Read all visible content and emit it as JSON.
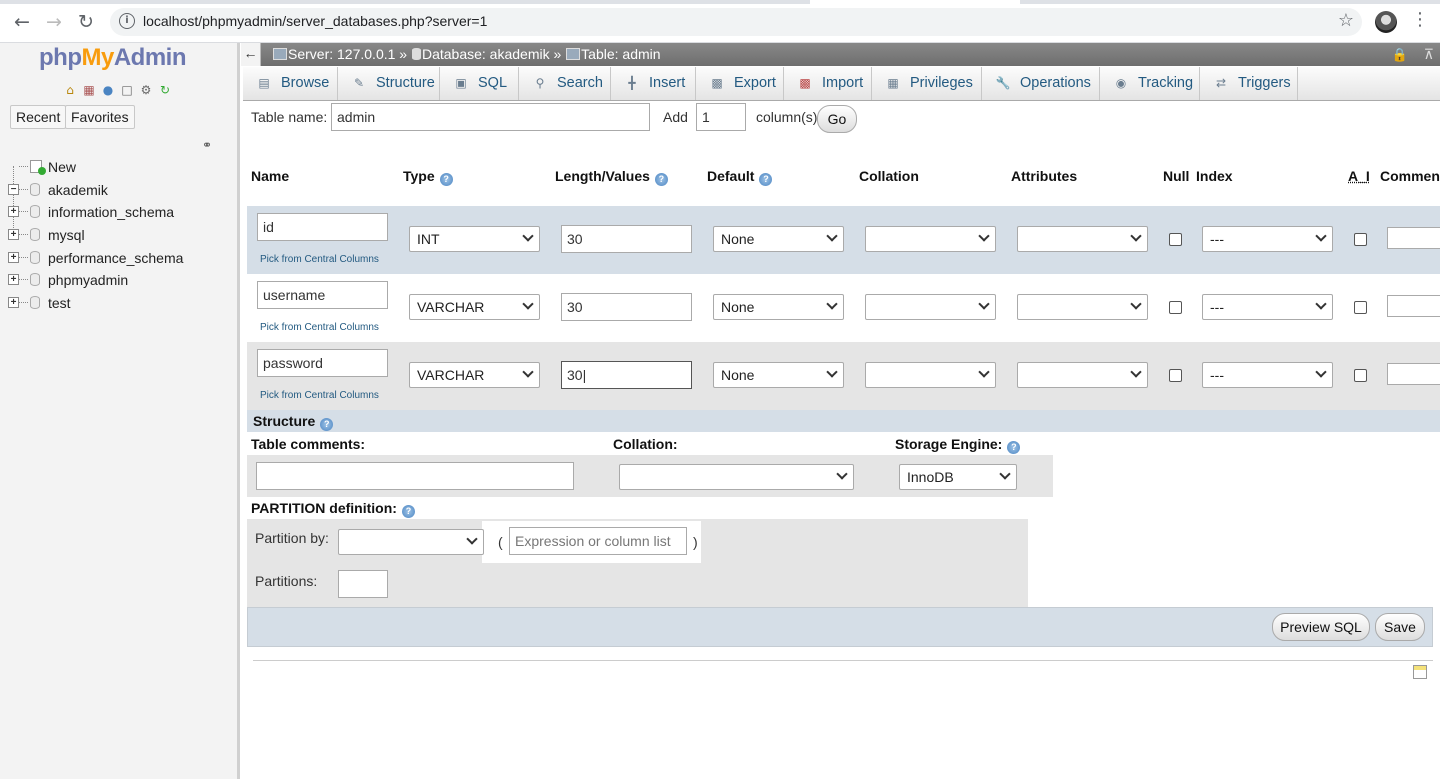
{
  "browser": {
    "url": "localhost/phpmyadmin/server_databases.php?server=1"
  },
  "nav": {
    "logo": {
      "php": "php",
      "my": "My",
      "admin": "Admin"
    },
    "recent_label": "Recent",
    "favorites_label": "Favorites",
    "tree": [
      {
        "label": "New",
        "expander": ""
      },
      {
        "label": "akademik",
        "expander": "−"
      },
      {
        "label": "information_schema",
        "expander": "+"
      },
      {
        "label": "mysql",
        "expander": "+"
      },
      {
        "label": "performance_schema",
        "expander": "+"
      },
      {
        "label": "phpmyadmin",
        "expander": "+"
      },
      {
        "label": "test",
        "expander": "+"
      }
    ]
  },
  "breadcrumb": {
    "server": "Server: 127.0.0.1 »",
    "database": "Database: akademik »",
    "table": "Table: admin"
  },
  "tabs": [
    {
      "label": "Browse",
      "icon": "browse-icon"
    },
    {
      "label": "Structure",
      "icon": "structure-icon"
    },
    {
      "label": "SQL",
      "icon": "sql-icon"
    },
    {
      "label": "Search",
      "icon": "search-icon"
    },
    {
      "label": "Insert",
      "icon": "insert-icon"
    },
    {
      "label": "Export",
      "icon": "export-icon"
    },
    {
      "label": "Import",
      "icon": "import-icon"
    },
    {
      "label": "Privileges",
      "icon": "privileges-icon"
    },
    {
      "label": "Operations",
      "icon": "operations-icon"
    },
    {
      "label": "Tracking",
      "icon": "tracking-icon"
    },
    {
      "label": "Triggers",
      "icon": "triggers-icon"
    }
  ],
  "form": {
    "table_name_label": "Table name:",
    "table_name_value": "admin",
    "add_label": "Add",
    "add_value": "1",
    "columns_label": "column(s)",
    "go_label": "Go"
  },
  "headers": {
    "name": "Name",
    "type": "Type",
    "length": "Length/Values",
    "default": "Default",
    "collation": "Collation",
    "attributes": "Attributes",
    "null": "Null",
    "index": "Index",
    "ai": "A_I",
    "comments": "Comments"
  },
  "columns": [
    {
      "name": "id",
      "type": "INT",
      "length": "30",
      "default": "None",
      "collation": "",
      "attributes": "",
      "null": false,
      "index": "---",
      "ai": false,
      "comment": "",
      "pick_link": "Pick from Central Columns"
    },
    {
      "name": "username",
      "type": "VARCHAR",
      "length": "30",
      "default": "None",
      "collation": "",
      "attributes": "",
      "null": false,
      "index": "---",
      "ai": false,
      "comment": "",
      "pick_link": "Pick from Central Columns"
    },
    {
      "name": "password",
      "type": "VARCHAR",
      "length": "30|",
      "default": "None",
      "collation": "",
      "attributes": "",
      "null": false,
      "index": "---",
      "ai": false,
      "comment": "",
      "pick_link": "Pick from Central Columns"
    }
  ],
  "structure": {
    "title": "Structure",
    "table_comments_label": "Table comments:",
    "table_comments_value": "",
    "collation_label": "Collation:",
    "collation_value": "",
    "storage_engine_label": "Storage Engine:",
    "storage_engine_value": "InnoDB"
  },
  "partition": {
    "title": "PARTITION definition:",
    "partition_by_label": "Partition by:",
    "partition_by_value": "",
    "open_paren": "(",
    "expression_placeholder": "Expression or column list",
    "close_paren": ")",
    "partitions_label": "Partitions:",
    "partitions_value": ""
  },
  "actions": {
    "preview_sql": "Preview SQL",
    "save": "Save"
  },
  "colors": {
    "row_band_a": "#d5dee7",
    "row_band_b": "#e5e5e5",
    "link": "#235a81",
    "logo_blue": "#6c78af",
    "logo_orange": "#f89c0e"
  }
}
